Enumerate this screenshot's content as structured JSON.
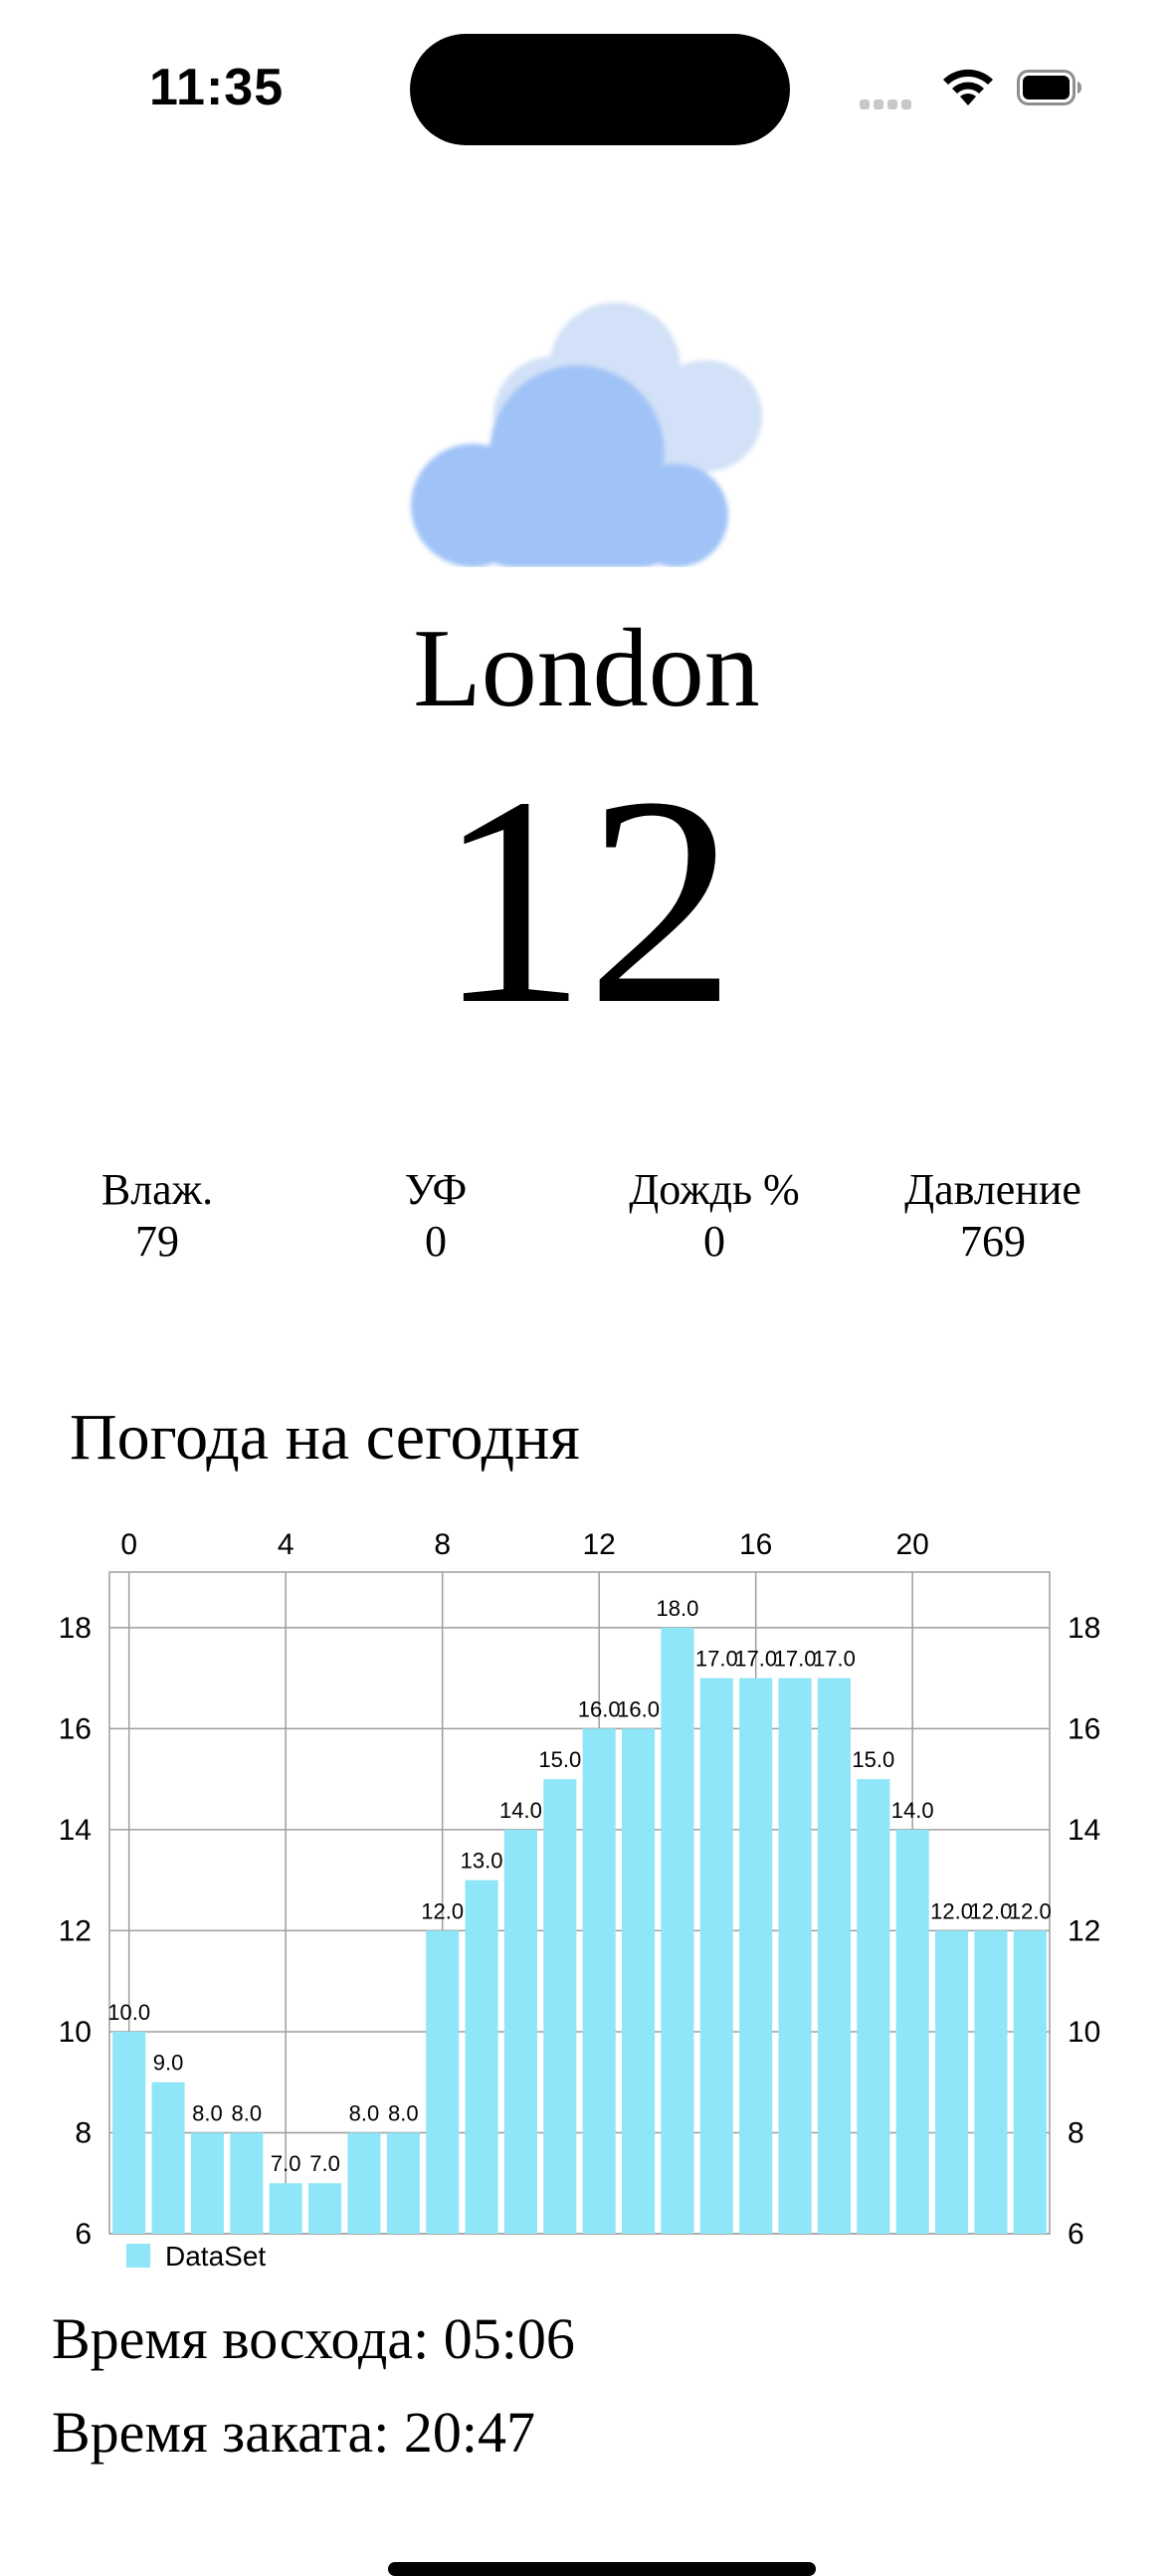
{
  "status_bar": {
    "time": "11:35",
    "battery_level_pct": 100
  },
  "weather": {
    "icon": "cloud-icon",
    "city": "London",
    "temperature": "12"
  },
  "stats": [
    {
      "label": "Влаж.",
      "value": "79"
    },
    {
      "label": "УФ",
      "value": "0"
    },
    {
      "label": "Дождь %",
      "value": "0"
    },
    {
      "label": "Давление",
      "value": "769"
    }
  ],
  "section_title": "Погода на сегодня",
  "chart_data": {
    "type": "bar",
    "x": [
      0,
      1,
      2,
      3,
      4,
      5,
      6,
      7,
      8,
      9,
      10,
      11,
      12,
      13,
      14,
      15,
      16,
      17,
      18,
      19,
      20,
      21,
      22,
      23
    ],
    "series": [
      {
        "name": "DataSet",
        "values": [
          10.0,
          9.0,
          8.0,
          8.0,
          7.0,
          7.0,
          8.0,
          8.0,
          12.0,
          13.0,
          14.0,
          15.0,
          16.0,
          16.0,
          18.0,
          17.0,
          17.0,
          17.0,
          17.0,
          15.0,
          14.0,
          12.0,
          12.0,
          12.0
        ]
      }
    ],
    "x_ticks": [
      "0",
      "4",
      "8",
      "12",
      "16",
      "20"
    ],
    "y_ticks": [
      "6",
      "8",
      "10",
      "12",
      "14",
      "16",
      "18"
    ],
    "ylim": [
      6,
      19.1
    ],
    "xlim": [
      -0.5,
      23.5
    ],
    "legend": "bottom-left",
    "grid": true,
    "bar_color": "#8ee6f8",
    "grid_color": "#9e9e9e"
  },
  "sun": {
    "sunrise": "Время восхода: 05:06",
    "sunset": "Время заката: 20:47"
  }
}
